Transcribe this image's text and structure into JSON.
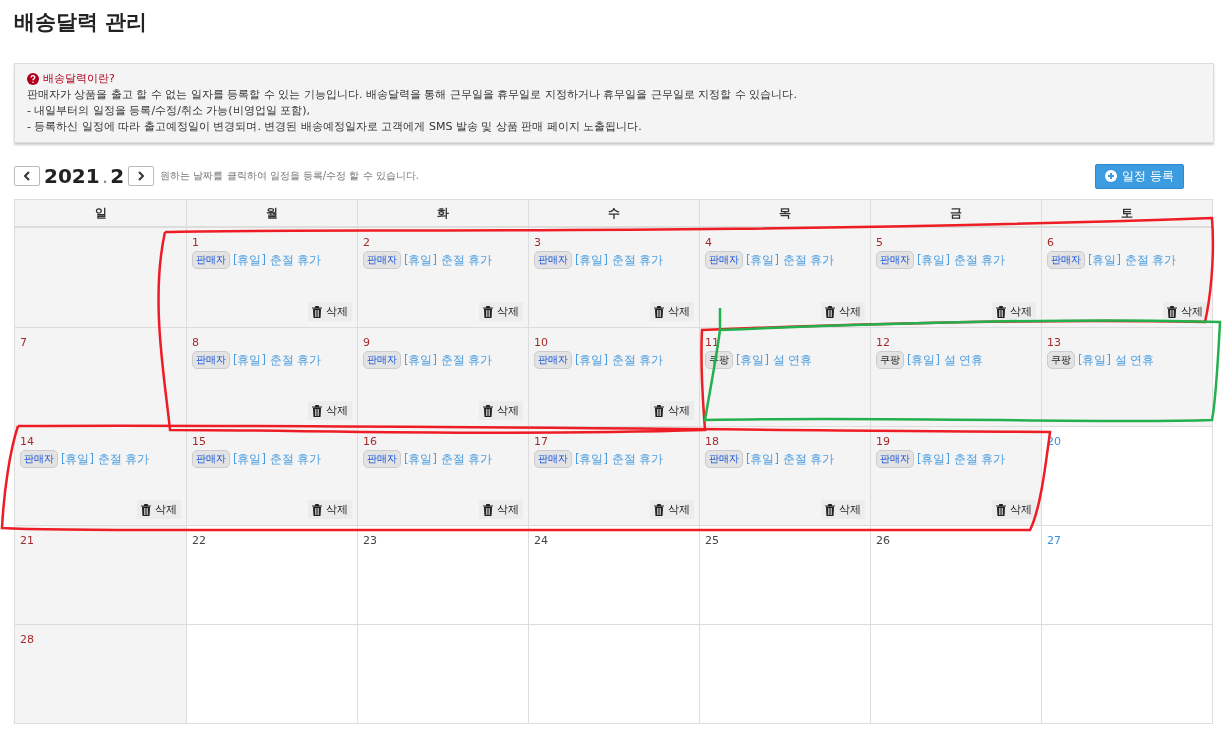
{
  "title": "배송달력 관리",
  "info": {
    "heading": "배송달력이란?",
    "lines": [
      "판매자가 상품을 출고 할 수 없는 일자를 등록할 수 있는 기능입니다. 배송달력을 통해 근무일을 휴무일로 지정하거나 휴무일을 근무일로 지정할 수 있습니다.",
      "- 내일부터의 일정을 등록/수정/취소 가능(비영업일 포함),",
      "- 등록하신 일정에 따라 출고예정일이 변경되며. 변경된 배송예정일자로 고객에게 SMS 발송 및 상품 판매 페이지 노출됩니다."
    ]
  },
  "nav": {
    "year": "2021",
    "separator": ".",
    "month": "2",
    "hint": "원하는 날짜를 클릭하여 일정을 등록/수정 할 수 있습니다.",
    "add_button": "일정 등록"
  },
  "weekdays": [
    "일",
    "월",
    "화",
    "수",
    "목",
    "금",
    "토"
  ],
  "weeks": [
    [
      {
        "off": true
      },
      {
        "day": "1",
        "off": true,
        "events": [
          {
            "kind": "seller",
            "tag": "판매자",
            "text": "[휴일] 춘절 휴가",
            "delete": "삭제"
          }
        ]
      },
      {
        "day": "2",
        "off": true,
        "events": [
          {
            "kind": "seller",
            "tag": "판매자",
            "text": "[휴일] 춘절 휴가",
            "delete": "삭제"
          }
        ]
      },
      {
        "day": "3",
        "off": true,
        "events": [
          {
            "kind": "seller",
            "tag": "판매자",
            "text": "[휴일] 춘절 휴가",
            "delete": "삭제"
          }
        ]
      },
      {
        "day": "4",
        "off": true,
        "events": [
          {
            "kind": "seller",
            "tag": "판매자",
            "text": "[휴일] 춘절 휴가",
            "delete": "삭제"
          }
        ]
      },
      {
        "day": "5",
        "off": true,
        "events": [
          {
            "kind": "seller",
            "tag": "판매자",
            "text": "[휴일] 춘절 휴가",
            "delete": "삭제"
          }
        ]
      },
      {
        "day": "6",
        "off": true,
        "events": [
          {
            "kind": "seller",
            "tag": "판매자",
            "text": "[휴일] 춘절 휴가",
            "delete": "삭제"
          }
        ]
      }
    ],
    [
      {
        "day": "7",
        "off": true
      },
      {
        "day": "8",
        "off": true,
        "events": [
          {
            "kind": "seller",
            "tag": "판매자",
            "text": "[휴일] 춘절 휴가",
            "delete": "삭제"
          }
        ]
      },
      {
        "day": "9",
        "off": true,
        "events": [
          {
            "kind": "seller",
            "tag": "판매자",
            "text": "[휴일] 춘절 휴가",
            "delete": "삭제"
          }
        ]
      },
      {
        "day": "10",
        "off": true,
        "events": [
          {
            "kind": "seller",
            "tag": "판매자",
            "text": "[휴일] 춘절 휴가",
            "delete": "삭제"
          }
        ]
      },
      {
        "day": "11",
        "off": true,
        "events": [
          {
            "kind": "platform",
            "tag": "쿠팡",
            "text": "[휴일] 설 연휴"
          }
        ]
      },
      {
        "day": "12",
        "off": true,
        "events": [
          {
            "kind": "platform",
            "tag": "쿠팡",
            "text": "[휴일] 설 연휴"
          }
        ]
      },
      {
        "day": "13",
        "off": true,
        "events": [
          {
            "kind": "platform",
            "tag": "쿠팡",
            "text": "[휴일] 설 연휴"
          }
        ]
      }
    ],
    [
      {
        "day": "14",
        "off": true,
        "events": [
          {
            "kind": "seller",
            "tag": "판매자",
            "text": "[휴일] 춘절 휴가",
            "delete": "삭제"
          }
        ]
      },
      {
        "day": "15",
        "off": true,
        "events": [
          {
            "kind": "seller",
            "tag": "판매자",
            "text": "[휴일] 춘절 휴가",
            "delete": "삭제"
          }
        ]
      },
      {
        "day": "16",
        "off": true,
        "events": [
          {
            "kind": "seller",
            "tag": "판매자",
            "text": "[휴일] 춘절 휴가",
            "delete": "삭제"
          }
        ]
      },
      {
        "day": "17",
        "off": true,
        "events": [
          {
            "kind": "seller",
            "tag": "판매자",
            "text": "[휴일] 춘절 휴가",
            "delete": "삭제"
          }
        ]
      },
      {
        "day": "18",
        "off": true,
        "events": [
          {
            "kind": "seller",
            "tag": "판매자",
            "text": "[휴일] 춘절 휴가",
            "delete": "삭제"
          }
        ]
      },
      {
        "day": "19",
        "off": true,
        "events": [
          {
            "kind": "seller",
            "tag": "판매자",
            "text": "[휴일] 춘절 휴가",
            "delete": "삭제"
          }
        ]
      },
      {
        "day": "20",
        "off": false
      }
    ],
    [
      {
        "day": "21",
        "off": true
      },
      {
        "day": "22",
        "off": false
      },
      {
        "day": "23",
        "off": false
      },
      {
        "day": "24",
        "off": false
      },
      {
        "day": "25",
        "off": false
      },
      {
        "day": "26",
        "off": false
      },
      {
        "day": "27",
        "off": false
      }
    ],
    [
      {
        "day": "28",
        "off": true
      }
    ]
  ],
  "annotations": [
    {
      "color": "#ee1c24"
    },
    {
      "color": "#ee1c24"
    },
    {
      "color": "#22b14c"
    }
  ]
}
